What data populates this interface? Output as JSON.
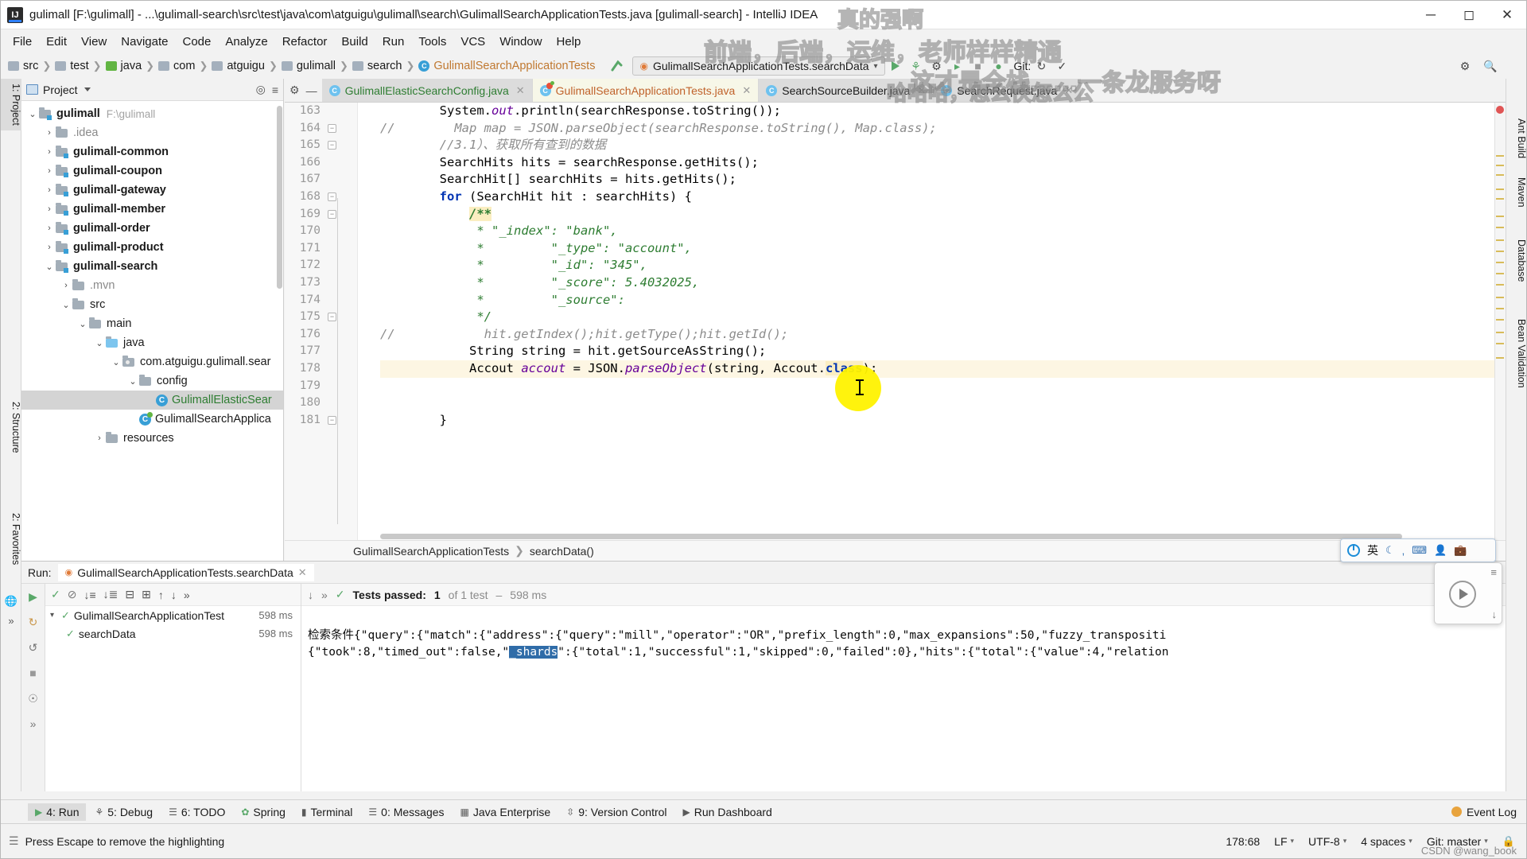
{
  "window": {
    "title": "gulimall [F:\\gulimall] - ...\\gulimall-search\\src\\test\\java\\com\\atguigu\\gulimall\\search\\GulimallSearchApplicationTests.java [gulimall-search] - IntelliJ IDEA",
    "app_icon": "IJ",
    "minimize": "─",
    "maximize": "☐",
    "close": "✕"
  },
  "menubar": [
    "File",
    "Edit",
    "View",
    "Navigate",
    "Code",
    "Analyze",
    "Refactor",
    "Build",
    "Run",
    "Tools",
    "VCS",
    "Window",
    "Help"
  ],
  "navbar": {
    "breadcrumbs": [
      {
        "label": "src",
        "icon": "folder-icon",
        "kind": "folder"
      },
      {
        "label": "test",
        "icon": "folder-icon",
        "kind": "folder"
      },
      {
        "label": "java",
        "icon": "source-folder-icon",
        "kind": "green"
      },
      {
        "label": "com",
        "icon": "package-icon",
        "kind": "folder"
      },
      {
        "label": "atguigu",
        "icon": "package-icon",
        "kind": "folder"
      },
      {
        "label": "gulimall",
        "icon": "package-icon",
        "kind": "folder"
      },
      {
        "label": "search",
        "icon": "package-icon",
        "kind": "folder"
      },
      {
        "label": "GulimallSearchApplicationTests",
        "icon": "class-icon",
        "kind": "class"
      }
    ],
    "run_config": "GulimallSearchApplicationTests.searchData",
    "git_label": "Git:",
    "icons": [
      "back-arrow-icon",
      "run-icon",
      "debug-icon",
      "run-with-coverage-icon",
      "profile-icon",
      "stop-icon",
      "search-everywhere-icon",
      "settings-icon"
    ]
  },
  "left_rail": {
    "top": [
      {
        "label": "1: Project",
        "selected": true
      },
      {
        "label": "2: Structure",
        "selected": false
      },
      {
        "label": "2: Favorites",
        "selected": false
      }
    ],
    "icons": [
      "web-icon",
      "more-icon"
    ]
  },
  "right_rail": [
    "Ant Build",
    "Maven",
    "Database",
    "Bean Validation"
  ],
  "project_panel": {
    "title": "Project",
    "actions": [
      "locate-icon",
      "collapse-all-icon",
      "settings-icon",
      "hide-icon"
    ],
    "tree": [
      {
        "indent": 0,
        "arrow": "⌄",
        "label": "gulimall",
        "bold": true,
        "path": "F:\\gulimall",
        "icon": "module-folder-icon"
      },
      {
        "indent": 1,
        "arrow": "›",
        "label": ".idea",
        "bold": false,
        "dim": true,
        "icon": "folder-icon"
      },
      {
        "indent": 1,
        "arrow": "›",
        "label": "gulimall-common",
        "bold": true,
        "icon": "module-folder-icon"
      },
      {
        "indent": 1,
        "arrow": "›",
        "label": "gulimall-coupon",
        "bold": true,
        "icon": "module-folder-icon"
      },
      {
        "indent": 1,
        "arrow": "›",
        "label": "gulimall-gateway",
        "bold": true,
        "icon": "module-folder-icon"
      },
      {
        "indent": 1,
        "arrow": "›",
        "label": "gulimall-member",
        "bold": true,
        "icon": "module-folder-icon"
      },
      {
        "indent": 1,
        "arrow": "›",
        "label": "gulimall-order",
        "bold": true,
        "icon": "module-folder-icon"
      },
      {
        "indent": 1,
        "arrow": "›",
        "label": "gulimall-product",
        "bold": true,
        "icon": "module-folder-icon"
      },
      {
        "indent": 1,
        "arrow": "⌄",
        "label": "gulimall-search",
        "bold": true,
        "icon": "module-folder-icon"
      },
      {
        "indent": 2,
        "arrow": "›",
        "label": ".mvn",
        "bold": false,
        "dim": true,
        "icon": "folder-icon"
      },
      {
        "indent": 2,
        "arrow": "⌄",
        "label": "src",
        "bold": false,
        "icon": "folder-icon"
      },
      {
        "indent": 3,
        "arrow": "⌄",
        "label": "main",
        "bold": false,
        "icon": "folder-icon"
      },
      {
        "indent": 4,
        "arrow": "⌄",
        "label": "java",
        "bold": false,
        "icon": "source-folder-icon"
      },
      {
        "indent": 5,
        "arrow": "⌄",
        "label": "com.atguigu.gulimall.sear",
        "bold": false,
        "icon": "package-icon"
      },
      {
        "indent": 6,
        "arrow": "⌄",
        "label": "config",
        "bold": false,
        "icon": "folder-icon"
      },
      {
        "indent": 7,
        "arrow": "",
        "label": "GulimallElasticSear",
        "bold": false,
        "icon": "class-icon",
        "selected": true,
        "green": true
      },
      {
        "indent": 6,
        "arrow": "",
        "label": "GulimallSearchApplica",
        "bold": false,
        "icon": "test-class-icon"
      },
      {
        "indent": 4,
        "arrow": "›",
        "label": "resources",
        "bold": false,
        "icon": "resource-folder-icon"
      }
    ]
  },
  "editor": {
    "tabs": [
      {
        "label": "GulimallElasticSearchConfig.java",
        "icon": "class-icon",
        "active": false,
        "green_text": true
      },
      {
        "label": "GulimallSearchApplicationTests.java",
        "icon": "test-class-icon",
        "active": true,
        "orange_text": true
      },
      {
        "label": "SearchSourceBuilder.java",
        "icon": "class-icon",
        "active": false
      },
      {
        "label": "SearchRequest.java",
        "icon": "class-icon",
        "active": false
      }
    ],
    "tab_buttons": [
      "settings-icon",
      "hide-icon"
    ],
    "first_line_number": 163,
    "lines": [
      {
        "n": 163,
        "fold": "",
        "html": "        <i>System</i>.<f>out</f>.println(searchResponse.toString());"
      },
      {
        "n": 164,
        "fold": "minus",
        "html": "<c>//        Map map = JSON.parseObject(searchResponse.toString(), Map.class);</c>"
      },
      {
        "n": 165,
        "fold": "minus2",
        "html": "<c>        //3.1）、获取所有查到的数据</c>"
      },
      {
        "n": 166,
        "fold": "",
        "html": "        SearchHits hits = searchResponse.getHits();"
      },
      {
        "n": 167,
        "fold": "",
        "html": "        SearchHit[] searchHits = hits.getHits();"
      },
      {
        "n": 168,
        "fold": "minus",
        "html": "        <k>for</k> (SearchHit hit : searchHits) {"
      },
      {
        "n": 169,
        "fold": "minus",
        "html": "            <dh>/**</dh>"
      },
      {
        "n": 170,
        "fold": "",
        "html": "             <d>* \"_index\": \"bank\",</d>"
      },
      {
        "n": 171,
        "fold": "",
        "html": "             <d>*         \"_type\": \"account\",</d>"
      },
      {
        "n": 172,
        "fold": "",
        "html": "             <d>*         \"_id\": \"345\",</d>"
      },
      {
        "n": 173,
        "fold": "",
        "html": "             <d>*         \"_score\": 5.4032025,</d>"
      },
      {
        "n": 174,
        "fold": "",
        "html": "             <d>*         \"_source\":</d>"
      },
      {
        "n": 175,
        "fold": "minus",
        "html": "             <d>*/</d>"
      },
      {
        "n": 176,
        "fold": "",
        "html": "<c>//            hit.getIndex();hit.getType();hit.getId();</c>"
      },
      {
        "n": 177,
        "fold": "",
        "html": "            String string = hit.getSourceAsString();"
      },
      {
        "n": 178,
        "fold": "",
        "html": "            Accout <f>accout</f> = JSON.<f>parseObject</f>(string, Accout.<hl>class</hl>);",
        "highlight": true
      },
      {
        "n": 179,
        "fold": "",
        "html": ""
      },
      {
        "n": 180,
        "fold": "",
        "html": ""
      },
      {
        "n": 181,
        "fold": "minus",
        "html": "        }"
      }
    ],
    "bottom_breadcrumb": [
      "GulimallSearchApplicationTests",
      "searchData()"
    ]
  },
  "run_panel": {
    "header_label": "Run:",
    "tab_label": "GulimallSearchApplicationTests.searchData",
    "tab_close": "✕",
    "header_actions": [
      "settings-icon",
      "hide-icon"
    ],
    "toolbar_icons": [
      "rerun-icon",
      "rerun-failed-icon",
      "stop-icon",
      "camera-icon"
    ],
    "tests_toolbar": [
      "show-passed-icon",
      "hide-ignored-icon",
      "sort-alphabetically-icon",
      "sort-duration-icon",
      "expand-all-icon",
      "collapse-all-icon",
      "prev-test-icon",
      "next-test-icon",
      "more-icon"
    ],
    "tests": [
      {
        "label": "GulimallSearchApplicationTest",
        "duration": "598 ms",
        "status": "passed",
        "indent": 0
      },
      {
        "label": "searchData",
        "duration": "598 ms",
        "status": "passed",
        "indent": 1
      }
    ],
    "status_line": {
      "prefix": "Tests passed:",
      "count": "1",
      "suffix": "of 1 test",
      "duration": "598 ms"
    },
    "console_lines": [
      "检索条件{\"query\":{\"match\":{\"address\":{\"query\":\"mill\",\"operator\":\"OR\",\"prefix_length\":0,\"max_expansions\":50,\"fuzzy_transpositi",
      "{\"took\":8,\"timed_out\":false,\"|shards\":{\"total\":1,\"successful\":1,\"skipped\":0,\"failed\":0},\"hits\":{\"total\":{\"value\":4,\"relation"
    ],
    "console_selection": "_shards"
  },
  "ime": {
    "lang": "英",
    "icons": [
      "moon-icon",
      "comma-icon",
      "keyboard-icon",
      "user-icon",
      "toolbox-icon"
    ]
  },
  "bottom_tabs": [
    {
      "label": "4: Run",
      "icon": "run-icon",
      "active": true
    },
    {
      "label": "5: Debug",
      "icon": "debug-icon",
      "active": false
    },
    {
      "label": "6: TODO",
      "icon": "todo-icon",
      "active": false
    },
    {
      "label": "Spring",
      "icon": "spring-icon",
      "active": false
    },
    {
      "label": "Terminal",
      "icon": "terminal-icon",
      "active": false
    },
    {
      "label": "0: Messages",
      "icon": "messages-icon",
      "active": false
    },
    {
      "label": "Java Enterprise",
      "icon": "java-ee-icon",
      "active": false
    },
    {
      "label": "9: Version Control",
      "icon": "vcs-icon",
      "active": false
    },
    {
      "label": "Run Dashboard",
      "icon": "dashboard-icon",
      "active": false
    }
  ],
  "event_log": {
    "label": "Event Log",
    "icon": "notification-icon"
  },
  "statusbar": {
    "message": "Press Escape to remove the highlighting",
    "caret_position": "178:68",
    "line_separator": "LF",
    "encoding": "UTF-8",
    "indent": "4 spaces",
    "git_branch": "Git: master",
    "lock_icon": "lock-icon"
  },
  "watermarks": [
    "真的强啊",
    "前端，后端，运维，老师样样精通",
    "这才是全栈……一条龙服务呀",
    "哈哈哈，怎么快怎么公"
  ],
  "credit": "CSDN @wang_book"
}
